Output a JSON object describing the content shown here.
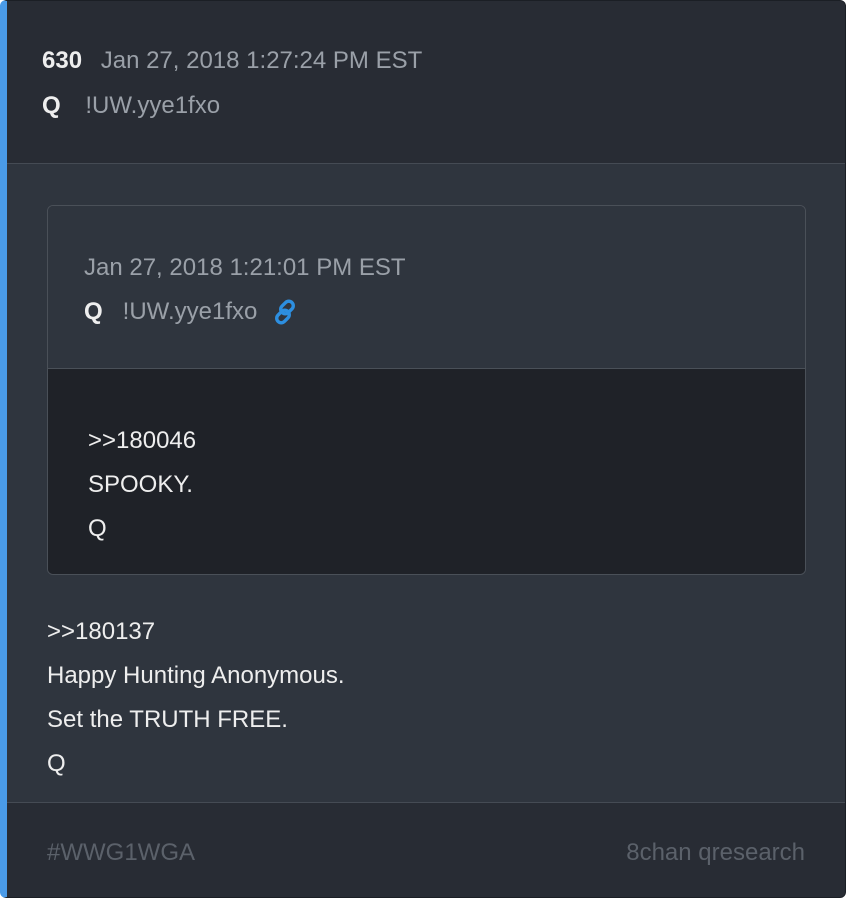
{
  "post": {
    "number": "630",
    "timestamp": "Jan 27, 2018 1:27:24 PM EST",
    "author": "Q",
    "tripcode": "!UW.yye1fxo",
    "body_lines": [
      ">>180137",
      "Happy Hunting Anonymous.",
      "Set the TRUTH FREE.",
      "Q"
    ]
  },
  "quoted_post": {
    "timestamp": "Jan 27, 2018 1:21:01 PM EST",
    "author": "Q",
    "tripcode": "!UW.yye1fxo",
    "link_icon": "link-icon",
    "body_lines": [
      ">>180046",
      "SPOOKY.",
      "Q"
    ]
  },
  "footer": {
    "tag": "#WWG1WGA",
    "source": "8chan qresearch"
  },
  "colors": {
    "accent": "#4a9be8",
    "link": "#2d8fe0",
    "background": "#2f353e",
    "header_background": "#282c34",
    "quoted_body_background": "#1f2228"
  }
}
